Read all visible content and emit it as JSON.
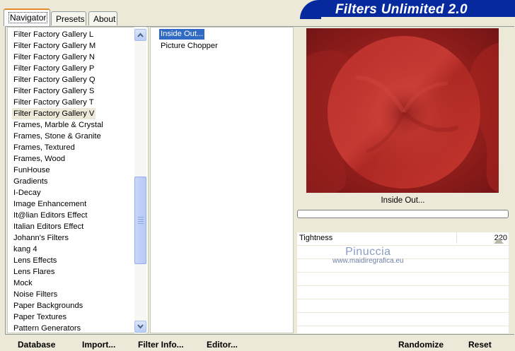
{
  "app": {
    "title": "Filters Unlimited 2.0"
  },
  "tabs": [
    {
      "label": "Navigator",
      "active": true
    },
    {
      "label": "Presets",
      "active": false
    },
    {
      "label": "About",
      "active": false
    }
  ],
  "categories": {
    "items": [
      "Filter Factory Gallery L",
      "Filter Factory Gallery M",
      "Filter Factory Gallery N",
      "Filter Factory Gallery P",
      "Filter Factory Gallery Q",
      "Filter Factory Gallery S",
      "Filter Factory Gallery T",
      "Filter Factory Gallery V",
      "Frames, Marble & Crystal",
      "Frames, Stone & Granite",
      "Frames, Textured",
      "Frames, Wood",
      "FunHouse",
      "Gradients",
      "I-Decay",
      "Image Enhancement",
      "It@lian Editors Effect",
      "Italian Editors Effect",
      "Johann's Filters",
      "kang 4",
      "Lens Effects",
      "Lens Flares",
      "Mock",
      "Noise Filters",
      "Paper Backgrounds",
      "Paper Textures",
      "Pattern Generators"
    ],
    "selected": "Filter Factory Gallery V"
  },
  "filters": {
    "items": [
      "Inside Out...",
      "Picture Chopper"
    ],
    "selected": "Inside Out..."
  },
  "preview": {
    "filter_name": "Inside Out..."
  },
  "params": [
    {
      "label": "Tightness",
      "value": "220"
    }
  ],
  "watermark": {
    "name": "Pinuccia",
    "url": "www.maidiregrafica.eu"
  },
  "buttons": {
    "database": "Database",
    "import": "Import...",
    "filter_info": "Filter Info...",
    "editor": "Editor...",
    "randomize": "Randomize",
    "reset": "Reset"
  },
  "colors": {
    "banner": "#062a9e",
    "selection": "#316ac5",
    "preview_red": "#b72a26"
  }
}
